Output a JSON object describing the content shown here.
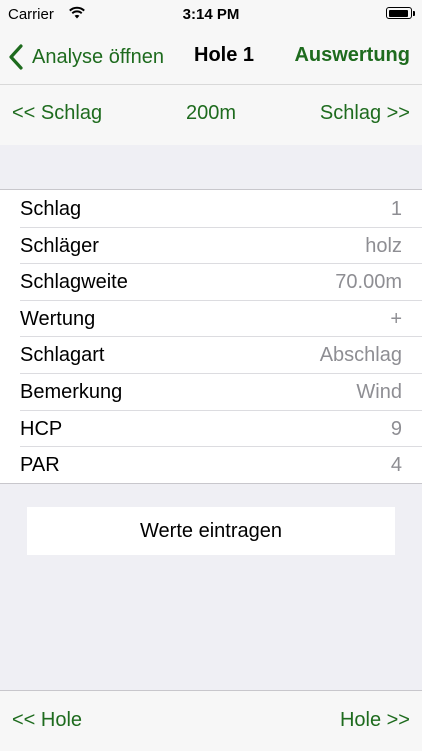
{
  "status_bar": {
    "carrier": "Carrier",
    "time": "3:14 PM"
  },
  "nav": {
    "back_label": "Analyse öffnen",
    "title": "Hole 1",
    "right_label": "Auswertung"
  },
  "stroke_nav": {
    "prev_label": "<< Schlag",
    "distance": "200m",
    "next_label": "Schlag >>"
  },
  "details": [
    {
      "label": "Schlag",
      "value": "1"
    },
    {
      "label": "Schläger",
      "value": "holz"
    },
    {
      "label": "Schlagweite",
      "value": "70.00m"
    },
    {
      "label": "Wertung",
      "value": "+"
    },
    {
      "label": "Schlagart",
      "value": "Abschlag"
    },
    {
      "label": "Bemerkung",
      "value": "Wind"
    },
    {
      "label": "HCP",
      "value": "9"
    },
    {
      "label": "PAR",
      "value": "4"
    }
  ],
  "enter_button_label": "Werte eintragen",
  "hole_nav": {
    "prev_label": "<< Hole",
    "next_label": "Hole >>"
  },
  "colors": {
    "accent": "#1e6b1e",
    "background": "#efeff4",
    "secondary_text": "#8e8e93"
  },
  "icons": {
    "wifi": "wifi-icon",
    "battery": "battery-icon",
    "back": "chevron-left-icon"
  }
}
